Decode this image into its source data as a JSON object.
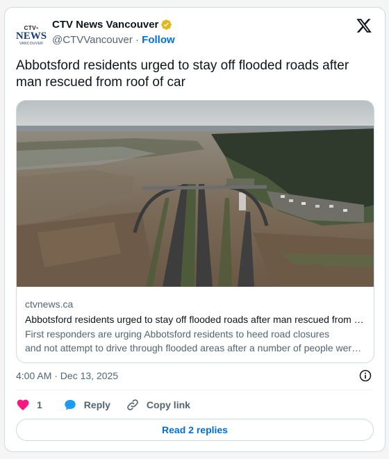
{
  "author": {
    "display_name": "CTV News Vancouver",
    "handle": "@CTVVancouver",
    "separator": "·",
    "follow_label": "Follow",
    "avatar_text": {
      "top": "CTV",
      "middle": "NEWS",
      "bottom": "VANCOUVER"
    },
    "verified_badge_color": "#e2b719"
  },
  "tweet": {
    "text": "Abbotsford residents urged to stay off flooded roads after man rescued from roof of car"
  },
  "link_card": {
    "domain": "ctvnews.ca",
    "title": "Abbotsford residents urged to stay off flooded roads after man rescued from roof of car",
    "description_line1": "First responders are urging Abbotsford residents to heed road closures",
    "description_line2": "and not attempt to drive through flooded areas after a number of people were rescued"
  },
  "meta": {
    "timestamp": "4:00 AM · Dec 13, 2025"
  },
  "actions": {
    "like_count": "1",
    "reply_label": "Reply",
    "copy_link_label": "Copy link",
    "read_replies_label": "Read 2 replies"
  },
  "colors": {
    "link_blue": "#006fd6",
    "like_pink": "#f91880",
    "secondary_text": "#536471",
    "border": "#cfd9de"
  }
}
